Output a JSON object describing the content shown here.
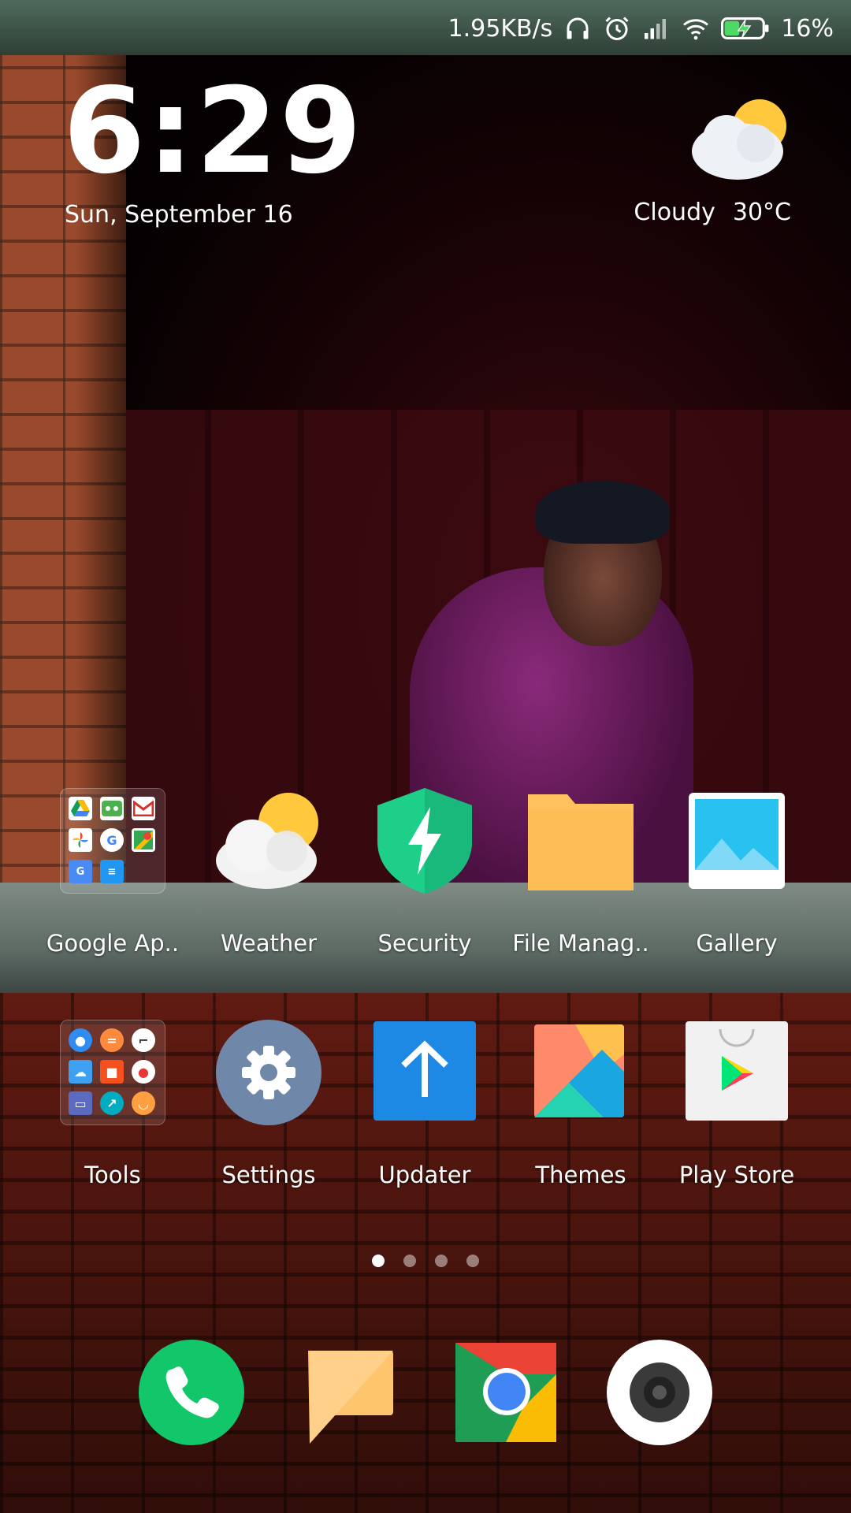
{
  "status_bar": {
    "network_speed": "1.95KB/s",
    "battery": "16%",
    "icons": [
      "headset-icon",
      "alarm-icon",
      "signal-icon",
      "wifi-icon",
      "battery-charging-icon"
    ]
  },
  "clock_widget": {
    "time": "6:29",
    "date": "Sun, September 16",
    "weather_condition": "Cloudy",
    "temperature": "30°C"
  },
  "apps_row1": [
    {
      "label": "Google Ap..",
      "name": "google-apps-folder"
    },
    {
      "label": "Weather",
      "name": "weather-app"
    },
    {
      "label": "Security",
      "name": "security-app"
    },
    {
      "label": "File Manag..",
      "name": "file-manager-app"
    },
    {
      "label": "Gallery",
      "name": "gallery-app"
    }
  ],
  "apps_row2": [
    {
      "label": "Tools",
      "name": "tools-folder"
    },
    {
      "label": "Settings",
      "name": "settings-app"
    },
    {
      "label": "Updater",
      "name": "updater-app"
    },
    {
      "label": "Themes",
      "name": "themes-app"
    },
    {
      "label": "Play Store",
      "name": "play-store-app"
    }
  ],
  "page_indicator": {
    "pages": 4,
    "active": 1
  },
  "dock": [
    "phone-app",
    "messaging-app",
    "chrome-app",
    "camera-app"
  ],
  "colors": {
    "security_green": "#1ecf8a",
    "folder_yellow": "#ffc15e",
    "updater_blue": "#1e88e5",
    "settings_grey": "#6f87a8",
    "phone_green": "#12c66a"
  }
}
